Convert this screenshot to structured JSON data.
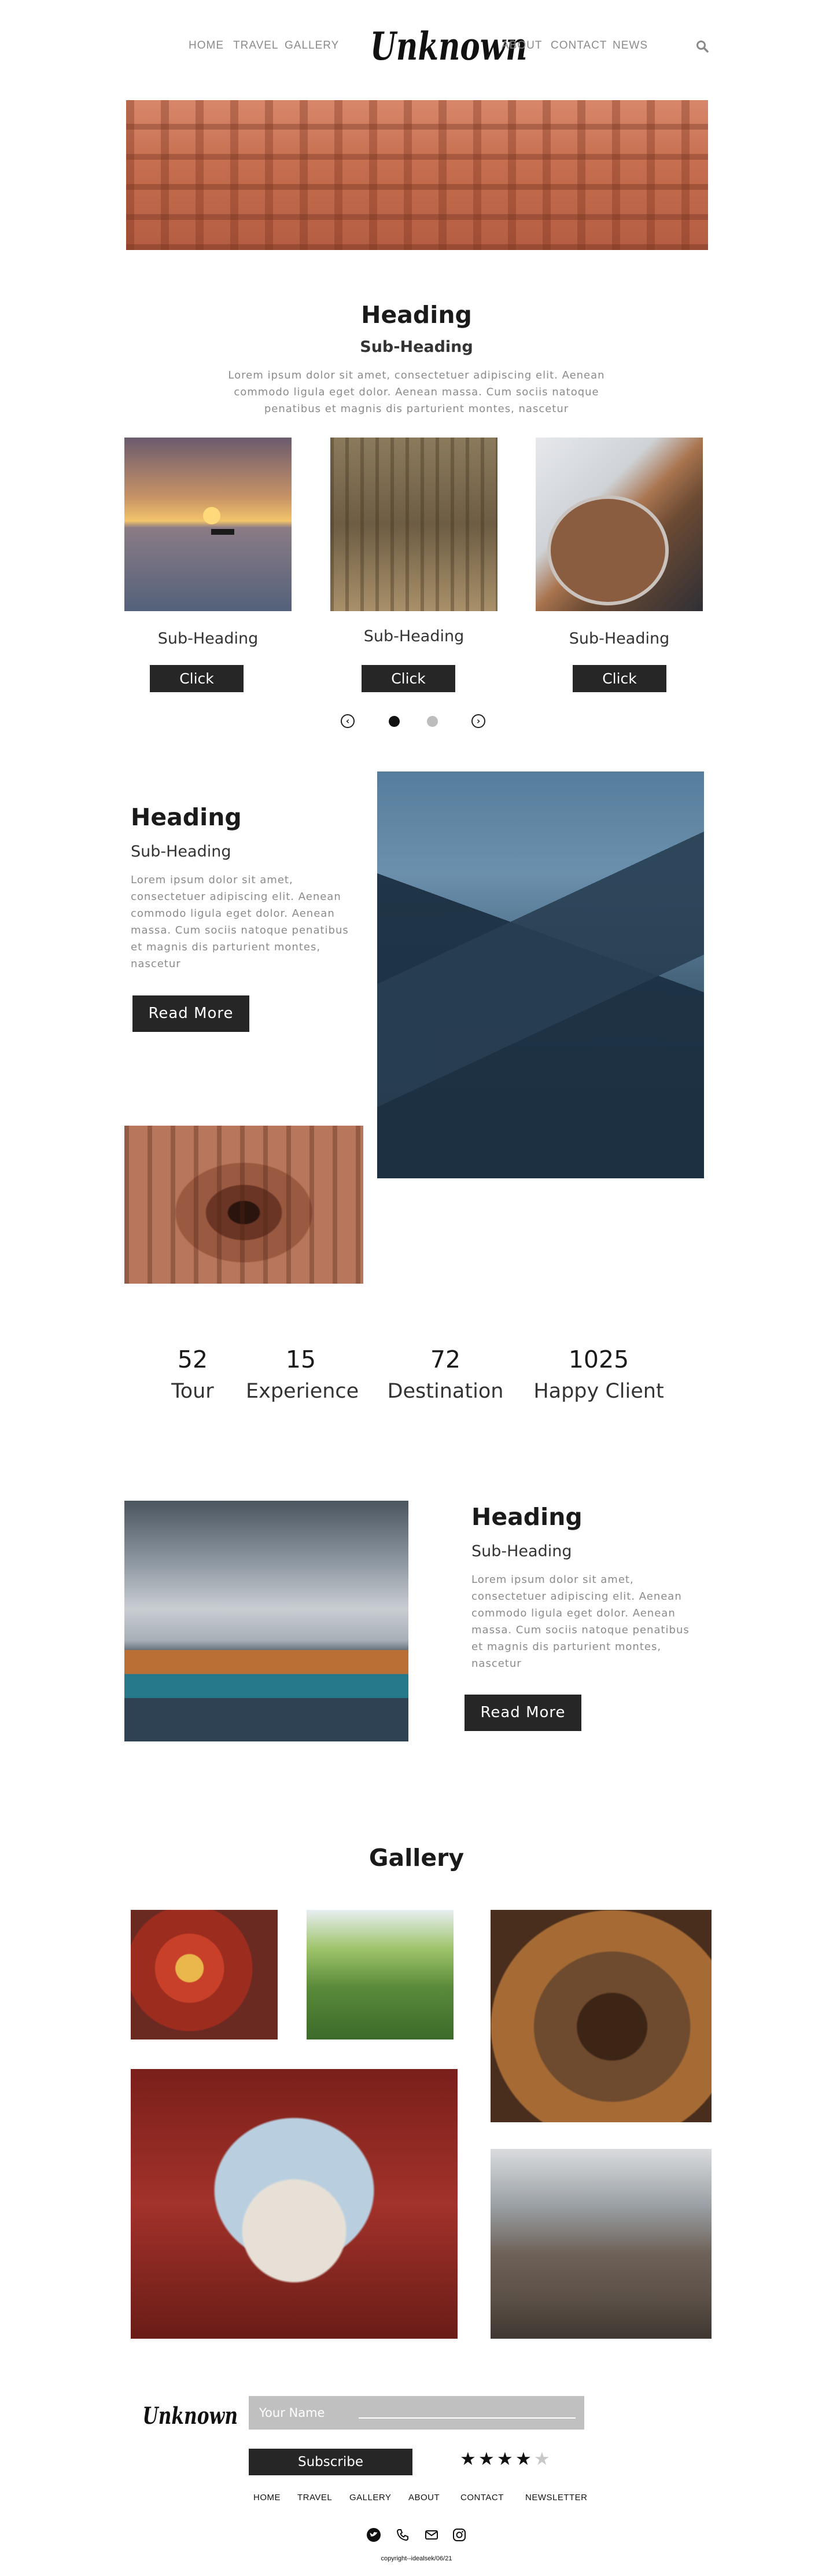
{
  "header": {
    "nav_left": [
      "HOME",
      "TRAVEL",
      "GALLERY"
    ],
    "nav_right": [
      "ABOUT",
      "CONTACT",
      "NEWS"
    ],
    "logo": "Unknown",
    "search_icon": "search-icon"
  },
  "intro": {
    "heading": "Heading",
    "subheading": "Sub-Heading",
    "text_line1": "Lorem ipsum dolor sit amet, consectetuer adipiscing elit. Aenean",
    "text_line2": "commodo ligula eget dolor. Aenean massa. Cum sociis natoque",
    "text_line3": "penatibus et magnis dis parturient montes, nascetur"
  },
  "cards": [
    {
      "subheading": "Sub-Heading",
      "button": "Click"
    },
    {
      "subheading": "Sub-Heading",
      "button": "Click"
    },
    {
      "subheading": "Sub-Heading",
      "button": "Click"
    }
  ],
  "carousel": {
    "active_index": 0,
    "dot_count": 2
  },
  "feature1": {
    "heading": "Heading",
    "subheading": "Sub-Heading",
    "lines": [
      "Lorem ipsum dolor sit amet,",
      "consectetuer adipiscing elit. Aenean",
      "commodo ligula eget dolor. Aenean",
      "massa. Cum sociis natoque penatibus",
      "et magnis dis parturient montes,",
      "nascetur"
    ],
    "button": "Read More"
  },
  "stats": [
    {
      "value": "52",
      "label": "Tour"
    },
    {
      "value": "15",
      "label": "Experience"
    },
    {
      "value": "72",
      "label": "Destination"
    },
    {
      "value": "1025",
      "label": "Happy Client"
    }
  ],
  "feature2": {
    "heading": "Heading",
    "subheading": "Sub-Heading",
    "lines": [
      "Lorem ipsum dolor sit amet,",
      "consectetuer adipiscing elit. Aenean",
      "commodo ligula eget dolor. Aenean",
      "massa. Cum sociis natoque penatibus",
      "et magnis dis parturient montes,",
      "nascetur"
    ],
    "button": "Read More"
  },
  "gallery": {
    "title": "Gallery"
  },
  "footer": {
    "logo": "Unknown",
    "name_placeholder": "Your Name",
    "subscribe": "Subscribe",
    "rating": {
      "filled": 4,
      "total": 5
    },
    "nav": [
      "HOME",
      "TRAVEL",
      "GALLERY",
      "ABOUT",
      "CONTACT",
      "NEWSLETTER"
    ],
    "social_icons": [
      "twitter-icon",
      "phone-icon",
      "mail-icon",
      "instagram-icon"
    ],
    "copyright": "copyright--idealsek/06/21"
  },
  "colors": {
    "dark": "#262626",
    "muted": "#8a8a8a",
    "input_bg": "#c0c0c0"
  }
}
